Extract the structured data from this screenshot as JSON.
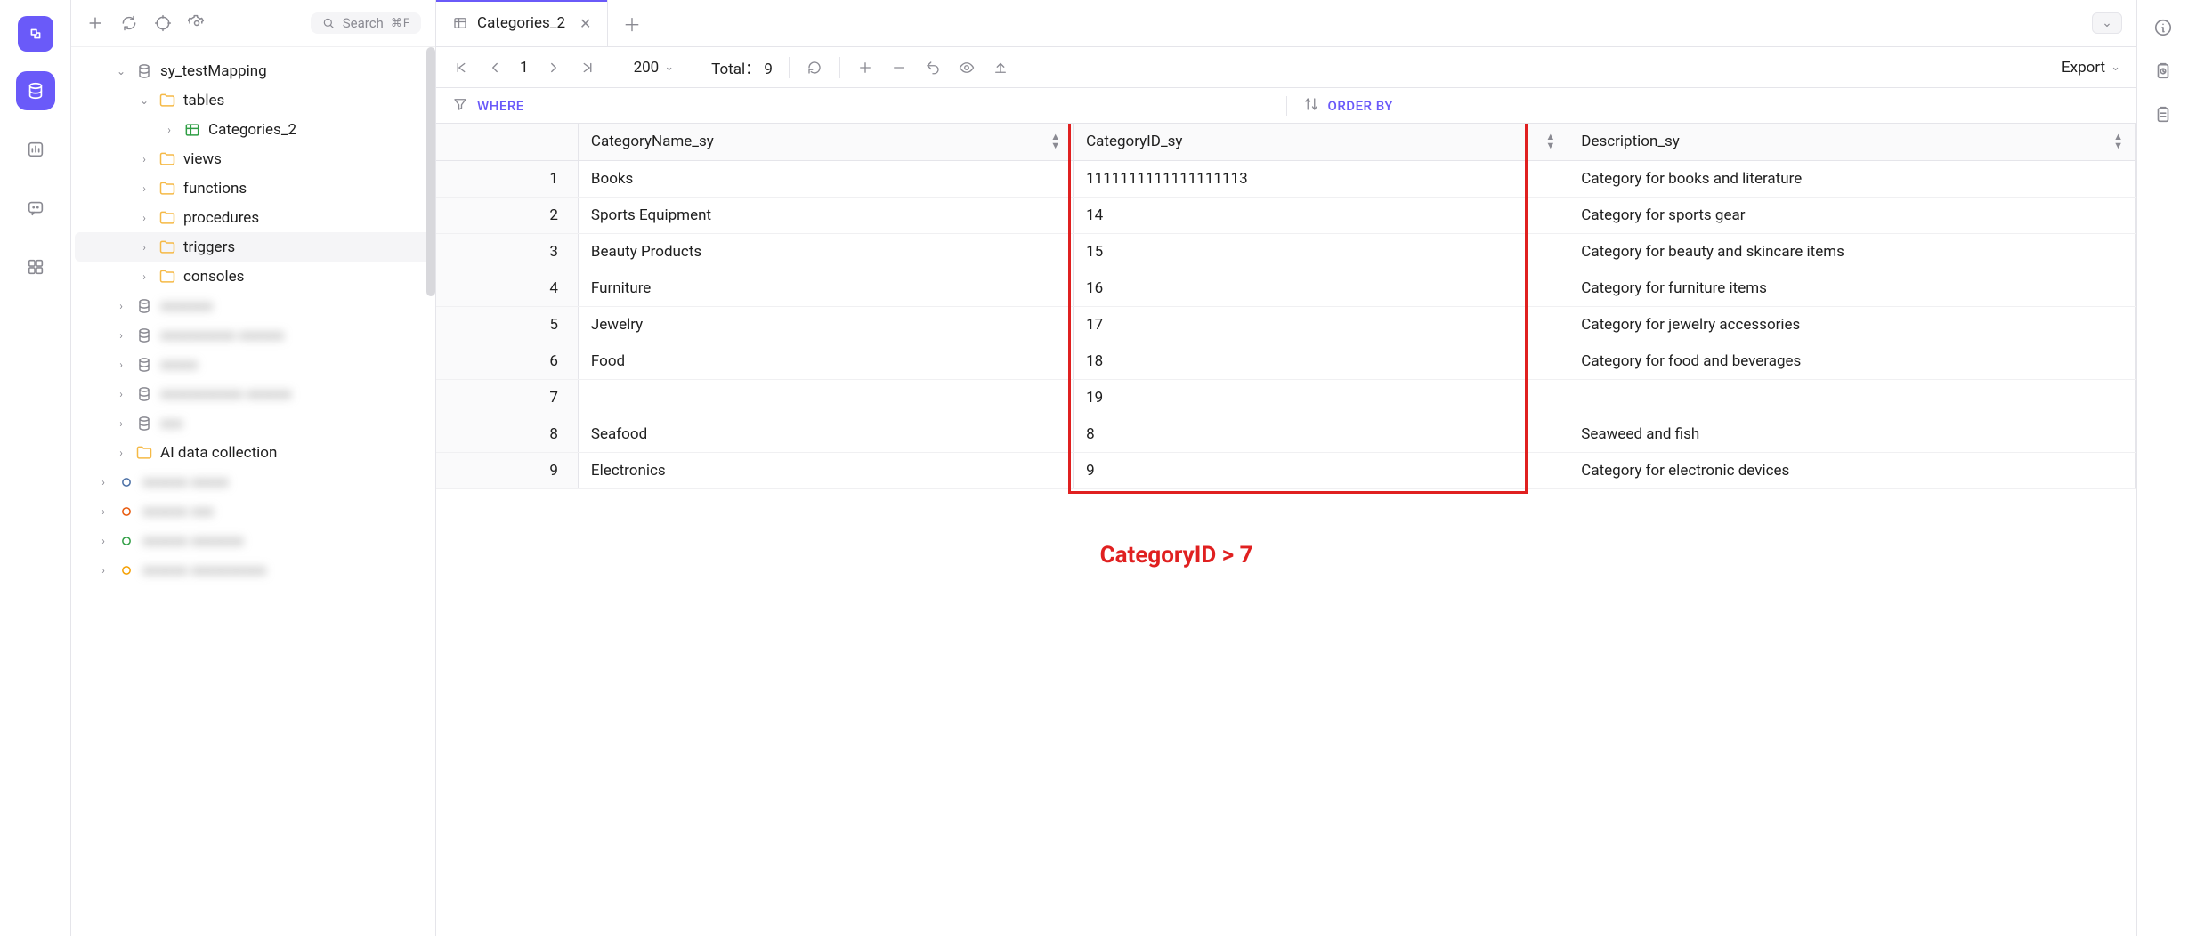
{
  "search": {
    "placeholder": "Search",
    "shortcut": "⌘F"
  },
  "tree": {
    "db": "sy_testMapping",
    "folders": {
      "tables": "tables",
      "views": "views",
      "functions": "functions",
      "procedures": "procedures",
      "triggers": "triggers",
      "consoles": "consoles"
    },
    "table_item": "Categories_2",
    "ai": "AI data collection",
    "blurred": [
      "xxxxxxx",
      "xxxxxxxxxx xxxxxx",
      "xxxxx",
      "xxxxxxxxxxx xxxxxx",
      "xxx"
    ],
    "blurred_hosts": [
      "xxxxxx xxxxx",
      "xxxxxx xxx",
      "xxxxxx xxxxxxx",
      "xxxxxx xxxxxxxxxx"
    ]
  },
  "tab": {
    "title": "Categories_2"
  },
  "toolbar": {
    "page": "1",
    "page_size": "200",
    "total_label": "Total：",
    "total_value": "9",
    "export": "Export"
  },
  "filters": {
    "where": "WHERE",
    "orderby": "ORDER BY"
  },
  "columns": {
    "name": "CategoryName_sy",
    "id": "CategoryID_sy",
    "desc": "Description_sy"
  },
  "rows": [
    {
      "n": "1",
      "name": "Books",
      "id": "1111111111111111113",
      "desc": "Category for books and literature"
    },
    {
      "n": "2",
      "name": "Sports Equipment",
      "id": "14",
      "desc": "Category for sports gear"
    },
    {
      "n": "3",
      "name": "Beauty Products",
      "id": "15",
      "desc": "Category for beauty and skincare items"
    },
    {
      "n": "4",
      "name": "Furniture",
      "id": "16",
      "desc": "Category for furniture items"
    },
    {
      "n": "5",
      "name": "Jewelry",
      "id": "17",
      "desc": "Category for jewelry accessories"
    },
    {
      "n": "6",
      "name": "Food",
      "id": "18",
      "desc": "Category for food and beverages"
    },
    {
      "n": "7",
      "name": "<null>",
      "id": "19",
      "desc": "<null>",
      "null_name": true,
      "null_desc": true
    },
    {
      "n": "8",
      "name": "Seafood",
      "id": "8",
      "desc": "Seaweed and fish"
    },
    {
      "n": "9",
      "name": "Electronics",
      "id": "9",
      "desc": "Category for electronic devices"
    }
  ],
  "annotation": "CategoryID > 7"
}
